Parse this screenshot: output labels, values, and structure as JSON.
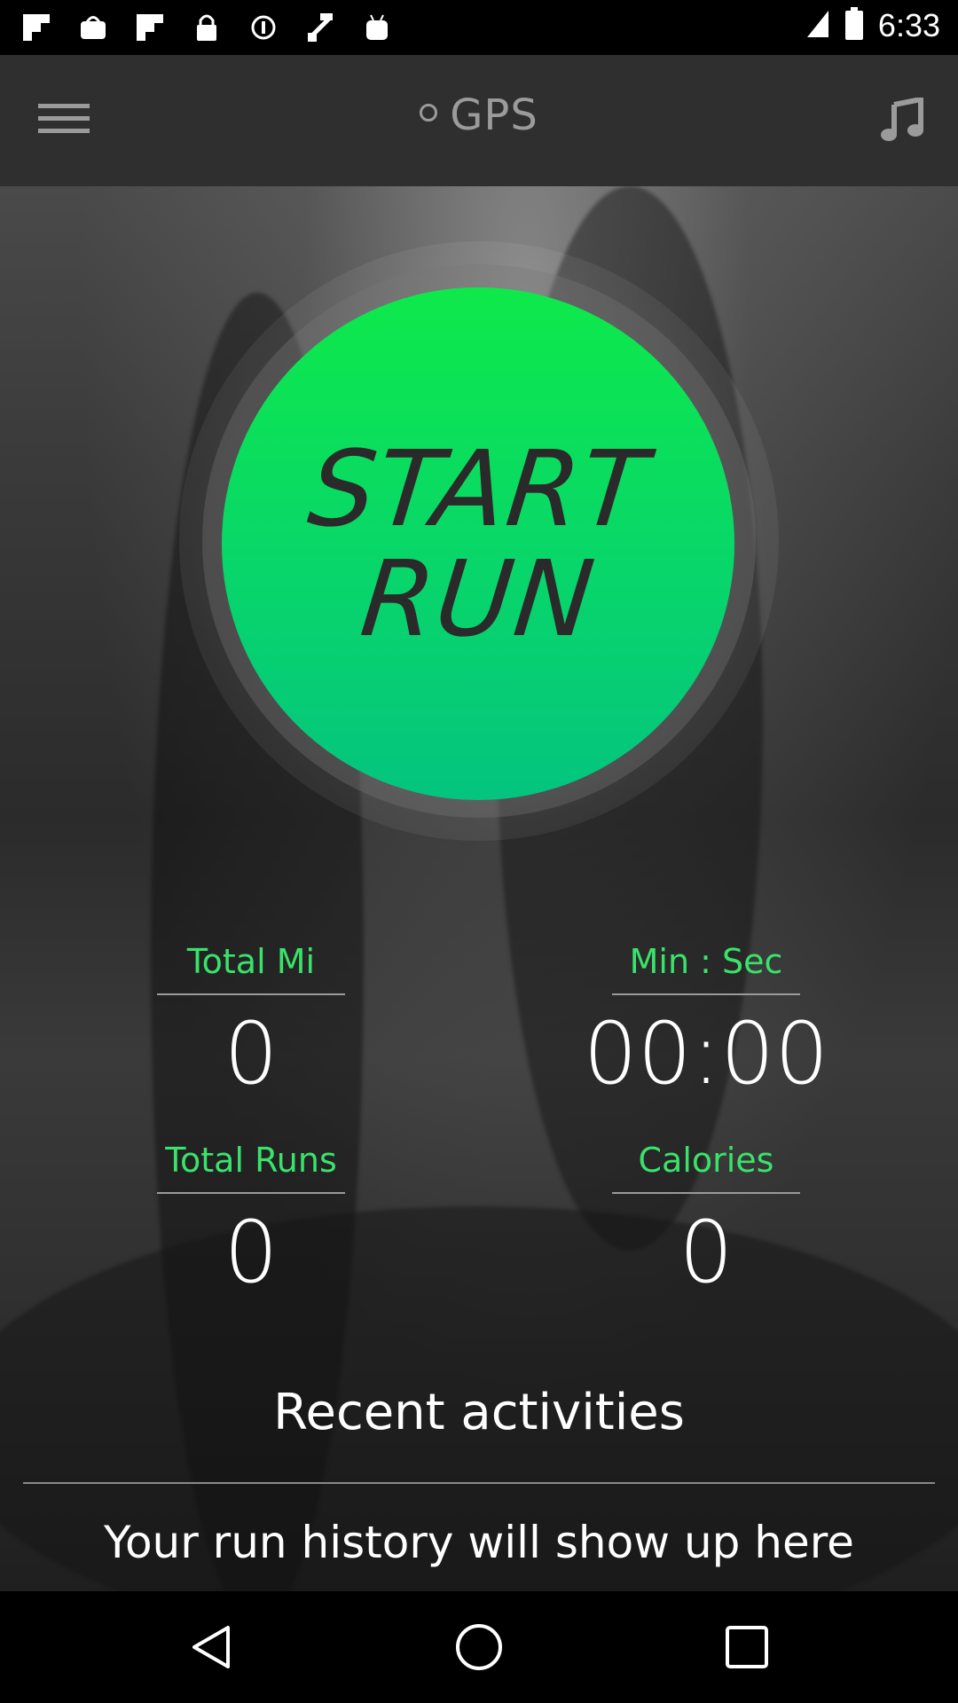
{
  "status_bar": {
    "time": "6:33",
    "icons": [
      "flipboard-icon",
      "bag-icon",
      "flipboard-icon",
      "lock-icon",
      "settings-icon",
      "fake-gps-icon",
      "android-icon"
    ]
  },
  "app_bar": {
    "title": "GPS",
    "menu_icon": "hamburger-menu-icon",
    "music_icon": "music-note-icon"
  },
  "start_button": {
    "line1": "START",
    "line2": "RUN"
  },
  "stats": {
    "total_mi": {
      "label": "Total Mi",
      "value": "0"
    },
    "min_sec": {
      "label": "Min : Sec",
      "value": "00:00"
    },
    "total_runs": {
      "label": "Total Runs",
      "value": "0"
    },
    "calories": {
      "label": "Calories",
      "value": "0"
    }
  },
  "recent": {
    "title": "Recent activities",
    "empty_message": "Your run history will show up here"
  },
  "colors": {
    "accent_green": "#39e36b",
    "button_green_top": "#0ee94a",
    "button_green_bottom": "#04c47f",
    "app_bar_bg": "#2f2f2f"
  },
  "nav_bar": {
    "back": "back-triangle-icon",
    "home": "home-circle-icon",
    "recents": "recents-square-icon"
  }
}
